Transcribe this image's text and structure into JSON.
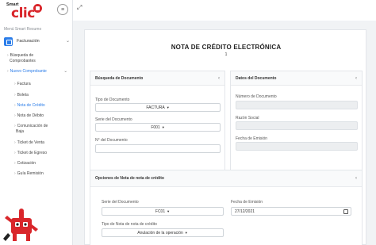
{
  "logo": {
    "smart": "Smart",
    "clic": "clic"
  },
  "sidebar": {
    "menu_header": "Menú Smart Resumo",
    "main_item": "Facturación",
    "items": [
      {
        "label": "Búsqueda de"
      },
      {
        "label": "Comprobantes"
      },
      {
        "label": "Nuevo Comprobante"
      },
      {
        "label": "Factura"
      },
      {
        "label": "Boleta"
      },
      {
        "label": "Nota de Crédito"
      },
      {
        "label": "Nota de Débito"
      },
      {
        "label": "Comunicación de"
      },
      {
        "label": "Baja"
      },
      {
        "label": "Ticket de Venta"
      },
      {
        "label": "Ticket de Egreso"
      },
      {
        "label": "Cotización"
      },
      {
        "label": "Guía Remisión"
      }
    ]
  },
  "topbar": {
    "hamburger": "≡",
    "expand": "⤢"
  },
  "main": {
    "title": "NOTA DE CRÉDITO ELECTRÓNICA",
    "subnum": "1"
  },
  "panel_busqueda": {
    "title": "Búsqueda de Documento",
    "tipo_label": "Tipo de Documento",
    "tipo_value": "FACTURA",
    "serie_label": "Serie del Documento",
    "serie_value": "F001",
    "numero_label": "N° del Documento",
    "numero_value": ""
  },
  "panel_datos": {
    "title": "Datos del Documento",
    "numero_label": "Número de Documento",
    "razon_label": "Razón Social",
    "fecha_label": "Fecha de Emisión"
  },
  "panel_opciones": {
    "title": "Opciones de Nota de nota de crédito",
    "serie_label": "Serie del Documento",
    "serie_value": "FC01",
    "fecha_label": "Fecha de Emisión",
    "fecha_value": "27/12/2021",
    "tipo_nota_label": "Tipo de Nota de nota de crédito",
    "tipo_nota_value": "Anulación de la operación"
  },
  "colors": {
    "accent": "#2b7de9",
    "brand": "#d9262b"
  }
}
